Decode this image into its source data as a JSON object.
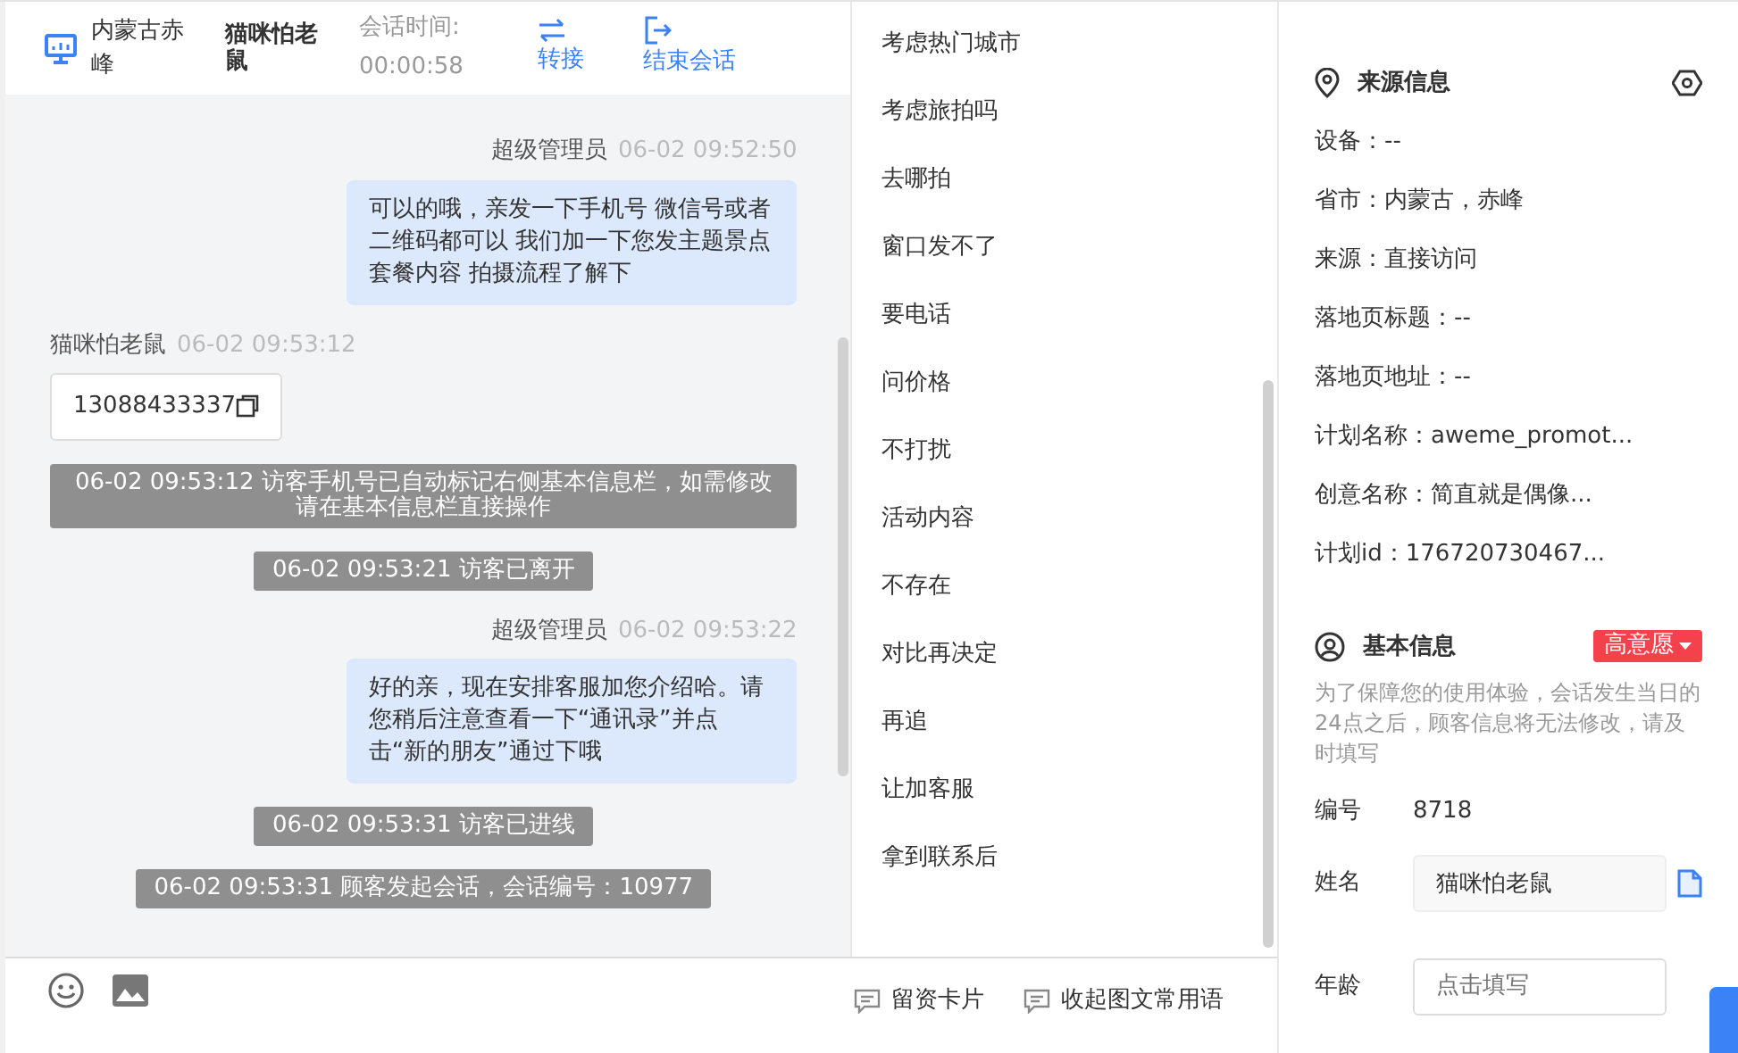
{
  "header": {
    "location": "内蒙古赤峰",
    "visitor_name": "猫咪怕老鼠",
    "duration_label": "会话时间:",
    "duration": "00:00:58",
    "actions": [
      {
        "kind": "transfer",
        "label": "转接"
      },
      {
        "kind": "end",
        "label": "结束会话"
      }
    ]
  },
  "messages": [
    {
      "kind": "agent",
      "sender": "超级管理员",
      "time": "06-02 09:52:50",
      "text": "可以的哦，亲发一下手机号 微信号或者二维码都可以 我们加一下您发主题景点套餐内容 拍摄流程了解下"
    },
    {
      "kind": "visitor",
      "sender": "猫咪怕老鼠",
      "time": "06-02 09:53:12",
      "text": "13088433337"
    },
    {
      "kind": "system",
      "text": "06-02 09:53:12 访客手机号已自动标记右侧基本信息栏，如需修改请在基本信息栏直接操作"
    },
    {
      "kind": "system",
      "text": "06-02 09:53:21 访客已离开"
    },
    {
      "kind": "agent",
      "sender": "超级管理员",
      "time": "06-02 09:53:22",
      "text": "好的亲，现在安排客服加您介绍哈。请您稍后注意查看一下“通讯录”并点击“新的朋友”通过下哦"
    },
    {
      "kind": "system",
      "text": "06-02 09:53:31 访客已进线"
    },
    {
      "kind": "system",
      "text": "06-02 09:53:31 顾客发起会话，会话编号：10977"
    }
  ],
  "quick_replies": [
    "考虑热门城市",
    "考虑旅拍吗",
    "去哪拍",
    "窗口发不了",
    "要电话",
    "问价格",
    "不打扰",
    "活动内容",
    "不存在",
    "对比再决定",
    "再追",
    "让加客服",
    "拿到联系后"
  ],
  "toolbar": {
    "buttons": [
      "留资卡片",
      "收起图文常用语"
    ]
  },
  "source_info": {
    "title": "来源信息",
    "fields": [
      "设备：--",
      "省市：内蒙古，赤峰",
      "来源：直接访问",
      "落地页标题：--",
      "落地页地址：--",
      "计划名称：aweme_promot...",
      "创意名称：简直就是偶像...",
      "计划id：176720730467..."
    ]
  },
  "basic_info": {
    "title": "基本信息",
    "intent": "高意愿",
    "notice": "为了保障您的使用体验，会话发生当日的24点之后，顾客信息将无法修改，请及时填写",
    "fields": [
      {
        "kind": "text",
        "label": "编号",
        "value": "8718"
      },
      {
        "kind": "input",
        "label": "姓名",
        "value": "猫咪怕老鼠"
      },
      {
        "kind": "input",
        "label": "年龄",
        "placeholder": "点击填写"
      }
    ]
  }
}
